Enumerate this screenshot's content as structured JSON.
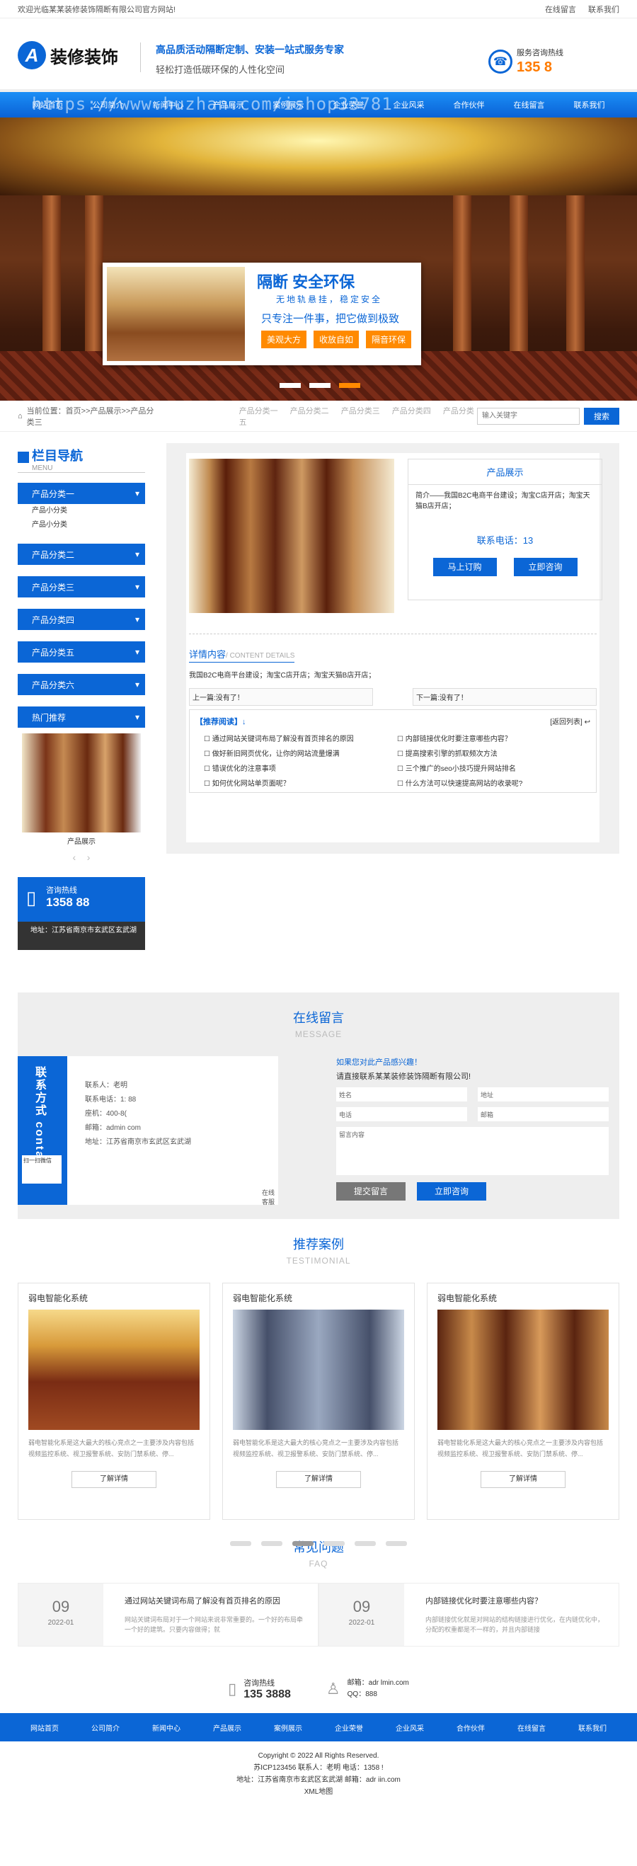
{
  "topbar": {
    "welcome": "欢迎光临某某装修装饰隔断有限公司官方网站!",
    "links": [
      "在线留言",
      "联系我们"
    ]
  },
  "header": {
    "logo_letter": "A",
    "logo_text": "装修装饰",
    "slogan1": "高品质活动隔断定制、安装一站式服务专家",
    "slogan2": "轻松打造低碳环保的人性化空间",
    "hotline_label": "服务咨询热线",
    "hotline_number": "135          8"
  },
  "nav": {
    "items": [
      "网站首页",
      "公司简介",
      "新闻中心",
      "产品展示",
      "案例展示",
      "企业荣誉",
      "企业风采",
      "合作伙伴",
      "在线留言",
      "联系我们"
    ],
    "watermark": "https://www.huzhan.com/ishop33781"
  },
  "banner": {
    "title": "隔断  安全环保",
    "subtitle": "无地轨悬挂，稳定安全",
    "middle": "只专注一件事，把它做到极致",
    "tags": [
      "美观大方",
      "收放自如",
      "隔音环保"
    ]
  },
  "breadcrumb": {
    "label": "当前位置：首页>>产品展示>>产品分类三",
    "categories": [
      "产品分类一",
      "产品分类二",
      "产品分类三",
      "产品分类四",
      "产品分类五"
    ],
    "search_placeholder": "输入关键字",
    "search_button": "搜索"
  },
  "sidebar": {
    "title": "栏目导航",
    "title_en": "MENU",
    "cats": [
      "产品分类一",
      "产品分类二",
      "产品分类三",
      "产品分类四",
      "产品分类五",
      "产品分类六",
      "热门推荐"
    ],
    "subs": [
      "产品小分类",
      "产品小分类"
    ],
    "photo_label": "产品展示",
    "contact_label": "咨询热线",
    "contact_number": "1358      88",
    "address": "地址：江苏省南京市玄武区玄武湖"
  },
  "product": {
    "box_title": "产品展示",
    "intro": "简介——我国B2C电商平台建设；淘宝C店开店；淘宝天猫B店开店；",
    "tel": "联系电话：13",
    "btn_order": "马上订购",
    "btn_consult": "立即咨询",
    "detail_title": "详情内容",
    "detail_en": "/ CONTENT DETAILS",
    "detail_text": "我国B2C电商平台建设；淘宝C店开店；淘宝天猫B店开店；",
    "prev": "上一篇:没有了！",
    "next": "下一篇:没有了！",
    "related_title": "【推荐阅读】↓",
    "related_back": "[返回列表]",
    "related": [
      "通过网站关键词布局了解没有首页排名的原因",
      "内部链接优化时要注意哪些内容？",
      "做好新旧网页优化，让你的网站流量爆满",
      "提高搜索引擎的抓取频次方法",
      "错误优化的注意事项",
      "三个推广的seo小技巧提升网站排名",
      "如何优化网站单页面呢？",
      "什么方法可以快速提高网站的收录呢?"
    ]
  },
  "message": {
    "title": "在线留言",
    "title_en": "MESSAGE",
    "contact_vertical": "联系方式 contact",
    "qr_alt": "扫一扫微信",
    "info": [
      "联系人：老明",
      "联系电话：1:           88",
      "座机：400-8(",
      "邮箱：admin           com",
      "地址：江苏省南京市玄武区玄武湖"
    ],
    "online": "在线客服",
    "q1": "如果您对此产品感兴趣！",
    "q2": "请直接联系某某装修装饰隔断有限公司!",
    "fields": [
      "姓名",
      "电话",
      "地址",
      "邮箱"
    ],
    "textarea": "留言内容",
    "submit": "提交留言",
    "consult": "立即咨询"
  },
  "cases": {
    "title": "推荐案例",
    "title_en": "TESTIMONIAL",
    "items": [
      {
        "title": "弱电智能化系统",
        "desc": "弱电智能化系是这大最大的核心竞点之一主要涉及内容包括视频监控系统、视卫报警系统、安防门禁系统、停...",
        "more": "了解详情"
      },
      {
        "title": "弱电智能化系统",
        "desc": "弱电智能化系是这大最大的核心竞点之一主要涉及内容包括视频监控系统、视卫报警系统、安防门禁系统、停...",
        "more": "了解详情"
      },
      {
        "title": "弱电智能化系统",
        "desc": "弱电智能化系是这大最大的核心竞点之一主要涉及内容包括视频监控系统、视卫报警系统、安防门禁系统、停...",
        "more": "了解详情"
      }
    ]
  },
  "faq": {
    "title": "常见问题",
    "title_en": "FAQ",
    "items": [
      {
        "day": "09",
        "ym": "2022-01",
        "q": "通过网站关键词布局了解没有首页排名的原因",
        "a": "网站关键词布局对于一个网站来说非常重要的。一个好的布局牵一个好的建筑。只要内容做得；就"
      },
      {
        "day": "09",
        "ym": "2022-01",
        "q": "内部链接优化时要注意哪些内容？",
        "a": "内部链接优化就是对网站的结构链接进行优化，在内链优化中，分配的权重都是不一样的，并且内部链接"
      }
    ]
  },
  "footer": {
    "hotline_label": "咨询热线",
    "hotline_number": "135         3888",
    "mail": "邮箱：adr              lmin.com",
    "qq": "QQ：888",
    "nav": [
      "网站首页",
      "公司简介",
      "新闻中心",
      "产品展示",
      "案例展示",
      "企业荣誉",
      "企业风采",
      "合作伙伴",
      "在线留言",
      "联系我们"
    ],
    "copyright": "Copyright © 2022 All Rights Reserved.",
    "icp": "苏ICP123456  联系人：老明  电话：1358          !",
    "addr": "地址：江苏省南京市玄武区玄武湖    邮箱：adr             iin.com",
    "sitemap": "XML地图"
  }
}
